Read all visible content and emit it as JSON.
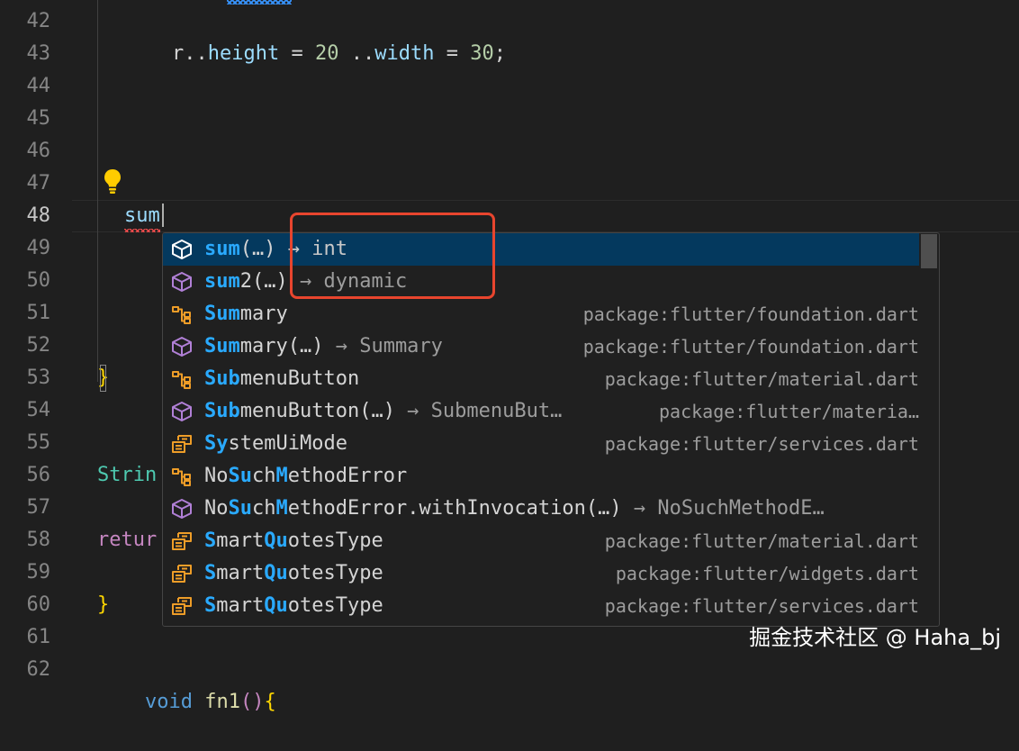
{
  "gutter": {
    "line_numbers": [
      "42",
      "43",
      "44",
      "45",
      "46",
      "47",
      "48",
      "49",
      "50",
      "51",
      "52",
      "53",
      "54",
      "55",
      "56",
      "57",
      "58",
      "59",
      "60",
      "61",
      "62"
    ],
    "active_line": "48"
  },
  "code": {
    "line42": {
      "p1": "r..",
      "p2": "height",
      "p3": " = ",
      "p4": "20",
      "p5": " ..",
      "p6": "width",
      "p7": " = ",
      "p8": "30",
      "p9": ";"
    },
    "line48_typed": "sum",
    "line53": "}",
    "line56": "Strin",
    "line58": "retur",
    "line60": "}",
    "line62": {
      "kw": "void",
      "name": "fn1",
      "paren": "()",
      "brace": "{"
    }
  },
  "suggestions": [
    {
      "icon": "method-icon",
      "match": "sum",
      "rest": "(…)",
      "detail": " → int",
      "source": ""
    },
    {
      "icon": "method-icon",
      "match": "sum",
      "rest": "2(…)",
      "detail": " → dynamic",
      "source": ""
    },
    {
      "icon": "class-icon",
      "match": "Sum",
      "rest": "mary",
      "detail": "",
      "source": "package:flutter/foundation.dart"
    },
    {
      "icon": "method-icon",
      "match": "Sum",
      "rest": "mary(…)",
      "detail": " → Summary",
      "source": "package:flutter/foundation.dart"
    },
    {
      "icon": "class-icon",
      "match": "Sub",
      "rest": "menuButton",
      "detail": "",
      "source": "package:flutter/material.dart"
    },
    {
      "icon": "method-icon",
      "match": "Sub",
      "rest": "menuButton(…)",
      "detail": " → SubmenuBut…",
      "source": "package:flutter/materia…"
    },
    {
      "icon": "enum-icon",
      "match": "Sy",
      "rest": "stemUiMode",
      "detail": "",
      "source": "package:flutter/services.dart"
    },
    {
      "icon": "class-icon",
      "match": "",
      "rest": "NoSuchMethodError",
      "detail": "",
      "source": ""
    },
    {
      "icon": "method-icon",
      "match": "",
      "rest": "NoSuchMethodError.withInvocation(…)",
      "detail": " → NoSuchMethodE…",
      "source": ""
    },
    {
      "icon": "enum-icon",
      "match": "S",
      "rest": "martQuotesType",
      "detail": "",
      "source": "package:flutter/material.dart"
    },
    {
      "icon": "enum-icon",
      "match": "S",
      "rest": "martQuotesType",
      "detail": "",
      "source": "package:flutter/widgets.dart"
    },
    {
      "icon": "enum-icon",
      "match": "S",
      "rest": "martQuotesType",
      "detail": "",
      "source": "package:flutter/services.dart"
    }
  ],
  "selected_index": 0,
  "colors": {
    "match_highlight": "#2aaaff",
    "selection": "#04395e",
    "method_icon": "#b180d7",
    "class_icon": "#ee9d28",
    "annotation_box": "#e8452e"
  },
  "watermark": "掘金技术社区 @ Haha_bj"
}
